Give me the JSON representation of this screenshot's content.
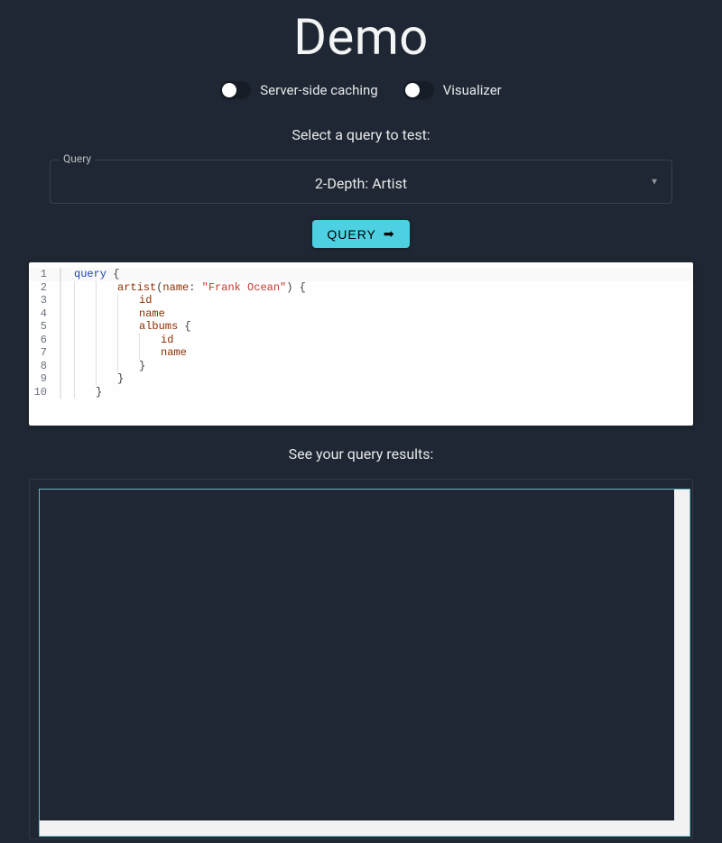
{
  "header": {
    "title": "Demo"
  },
  "toggles": {
    "server_side_caching": {
      "label": "Server-side caching",
      "on": false
    },
    "visualizer": {
      "label": "Visualizer",
      "on": false
    }
  },
  "query_select": {
    "legend": "Query",
    "selected": "2-Depth: Artist",
    "prompt": "Select a query to test:"
  },
  "buttons": {
    "query": "QUERY"
  },
  "editor": {
    "line_numbers": [
      "1",
      "2",
      "3",
      "4",
      "5",
      "6",
      "7",
      "8",
      "9",
      "10"
    ],
    "code": {
      "l1_kw": "query",
      "l1_brace": " {",
      "l2_field": "artist",
      "l2_open": "(",
      "l2_argname": "name",
      "l2_colon": ": ",
      "l2_str": "\"Frank Ocean\"",
      "l2_close": ") {",
      "l3": "id",
      "l4": "name",
      "l5_field": "albums",
      "l5_brace": " {",
      "l6": "id",
      "l7": "name",
      "l8": "}",
      "l9": "}",
      "l10": "}"
    }
  },
  "results": {
    "label": "See your query results:"
  }
}
